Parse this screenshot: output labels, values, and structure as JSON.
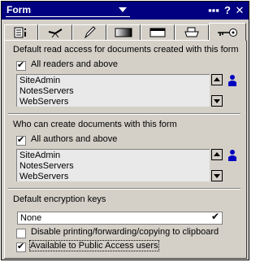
{
  "titlebar": {
    "title": "Form",
    "more_label": "▪▪▪",
    "help_label": "?",
    "close_label": "✕"
  },
  "tabs": [
    {
      "icon": "info-icon"
    },
    {
      "icon": "propeller-icon"
    },
    {
      "icon": "pen-icon"
    },
    {
      "icon": "gradient-icon"
    },
    {
      "icon": "window-icon"
    },
    {
      "icon": "printer-icon"
    },
    {
      "icon": "key-icon",
      "active": true
    }
  ],
  "read_access": {
    "heading": "Default read access for documents created with this form",
    "all_label": "All readers and above",
    "all_checked": true,
    "items": [
      "SiteAdmin",
      "NotesServers",
      "WebServers"
    ]
  },
  "create_access": {
    "heading": "Who can create documents with this form",
    "all_label": "All authors and above",
    "all_checked": true,
    "items": [
      "SiteAdmin",
      "NotesServers",
      "WebServers"
    ]
  },
  "encryption": {
    "heading": "Default encryption keys",
    "value": "None",
    "confirm_icon": "checkmark-icon"
  },
  "options": {
    "disable_printing_label": "Disable printing/forwarding/copying to clipboard",
    "disable_printing_checked": false,
    "public_access_label": "Available to Public Access users",
    "public_access_checked": true
  }
}
